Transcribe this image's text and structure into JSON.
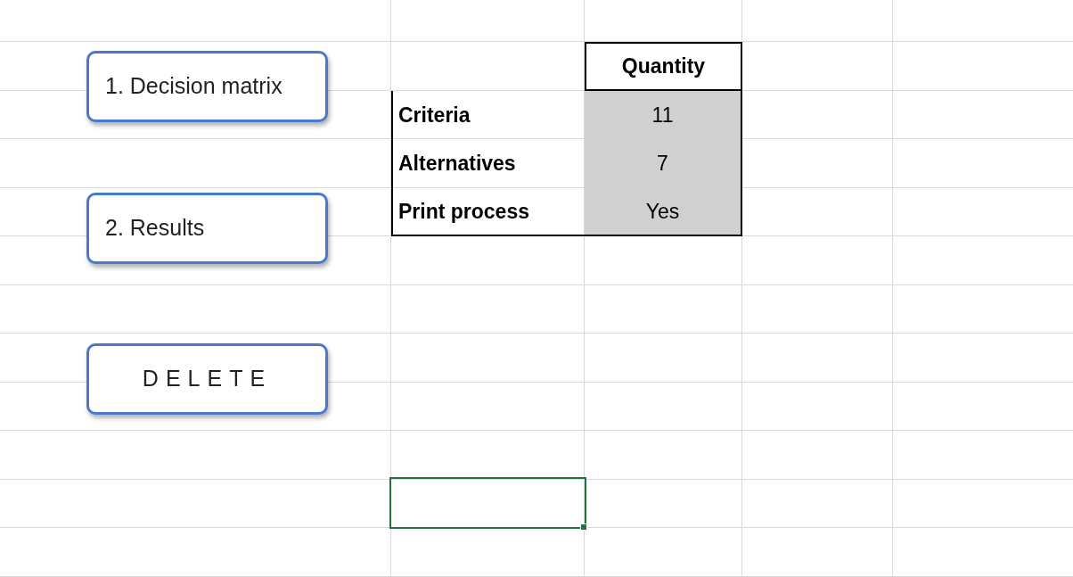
{
  "buttons": [
    {
      "label": "1. Decision matrix",
      "kind": "left"
    },
    {
      "label": "2. Results",
      "kind": "left"
    },
    {
      "label": "DELETE",
      "kind": "spaced"
    }
  ],
  "table": {
    "header": "Quantity",
    "rows": [
      {
        "label": "Criteria",
        "value": "11"
      },
      {
        "label": "Alternatives",
        "value": "7"
      },
      {
        "label": "Print process",
        "value": "Yes"
      }
    ]
  }
}
